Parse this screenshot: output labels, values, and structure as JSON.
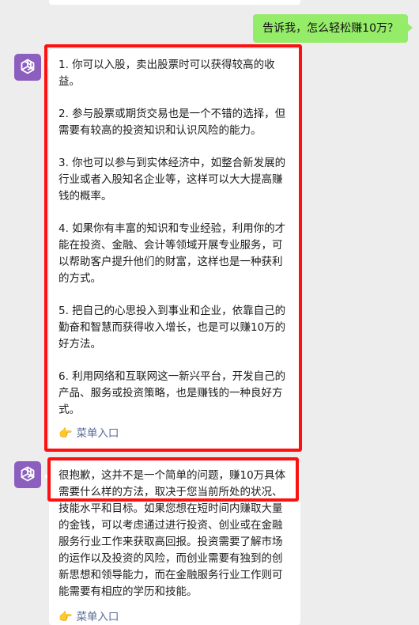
{
  "user_message": {
    "text": "告诉我，怎么轻松赚10万？"
  },
  "reply_1": {
    "paragraphs": [
      "1. 你可以入股，卖出股票时可以获得较高的收益。",
      "2. 参与股票或期货交易也是一个不错的选择，但需要有较高的投资知识和认识风险的能力。",
      "3. 你也可以参与到实体经济中，如整合新发展的行业或者入股知名企业等，这样可以大大提高赚钱的概率。",
      "4. 如果你有丰富的知识和专业经验，利用你的才能在投资、金融、会计等领域开展专业服务，可以帮助客户提升他们的财富，这样也是一种获利的方式。",
      "5. 把自己的心思投入到事业和企业，依靠自己的勤奋和智慧而获得收入增长，也是可以赚10万的好方法。",
      "6. 利用网络和互联网这一新兴平台，开发自己的产品、服务或投资策略，也是赚钱的一种良好方式。"
    ],
    "menu_link": "菜单入口",
    "menu_icon": "👉"
  },
  "reply_2": {
    "text": "很抱歉，这并不是一个简单的问题，赚10万具体需要什么样的方法，取决于您当前所处的状况、技能水平和目标。如果您想在短时间内赚取大量的金钱，可以考虑通过进行投资、创业或在金融服务行业工作来获取高回报。投资需要了解市场的运作以及投资的风险，而创业需要有独到的创新思想和领导能力，而在金融服务行业工作则可能需要有相应的学历和技能。",
    "menu_link": "菜单入口",
    "menu_icon": "👉"
  },
  "colors": {
    "background": "#ededed",
    "user_bubble": "#95ec69",
    "bot_bubble": "#ffffff",
    "link": "#576b95",
    "avatar": "#8c5fbf",
    "highlight": "#ff1010"
  },
  "icons": {
    "avatar": "openai-logo-icon",
    "menu": "pointing-hand-icon"
  }
}
